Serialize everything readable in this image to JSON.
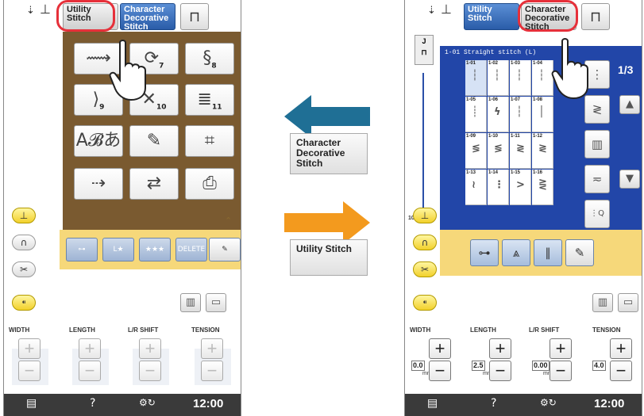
{
  "left_screen": {
    "tabs": {
      "utility": "Utility Stitch",
      "character": "Character Decorative Stitch"
    },
    "patterns": [
      {
        "glyph": "⟿",
        "num": ""
      },
      {
        "glyph": "⟳",
        "num": "7"
      },
      {
        "glyph": "§",
        "num": "8"
      },
      {
        "glyph": "⟩",
        "num": "9"
      },
      {
        "glyph": "✕",
        "num": "10"
      },
      {
        "glyph": "≣",
        "num": "11"
      },
      {
        "glyph": "A𝓑あ",
        "num": ""
      },
      {
        "glyph": "✎",
        "num": ""
      },
      {
        "glyph": "⌗",
        "num": ""
      },
      {
        "glyph": "⇢",
        "num": ""
      },
      {
        "glyph": "⇄",
        "num": ""
      },
      {
        "glyph": "⎙",
        "num": ""
      }
    ],
    "edit_buttons": {
      "delete": "DELETE"
    },
    "labels": {
      "width": "WIDTH",
      "length": "LENGTH",
      "shift": "L/R SHIFT",
      "tension": "TENSION"
    },
    "bottom": {
      "time": "12:00"
    }
  },
  "middle": {
    "label_top": "Character Decorative Stitch",
    "label_bottom": "Utility Stitch",
    "arrow_left_color": "#1f6f95",
    "arrow_right_color": "#f39a1e"
  },
  "right_screen": {
    "tabs": {
      "utility": "Utility Stitch",
      "character": "Character Decorative Stitch"
    },
    "header": "1-01  Straight stitch (L)",
    "page": "1/3",
    "zoom": "100%",
    "stitches": [
      "1-01",
      "1-02",
      "1-03",
      "1-04",
      "1-05",
      "1-06",
      "1-07",
      "1-08",
      "1-09",
      "1-10",
      "1-11",
      "1-12",
      "1-13",
      "1-14",
      "1-15",
      "1-16"
    ],
    "labels": {
      "width": "WIDTH",
      "length": "LENGTH",
      "shift": "L/R SHIFT",
      "tension": "TENSION"
    },
    "values": {
      "width": "0.0",
      "length": "2.5",
      "shift": "0.00",
      "tension": "4.0",
      "unit": "mm"
    },
    "bottom": {
      "time": "12:00"
    }
  }
}
